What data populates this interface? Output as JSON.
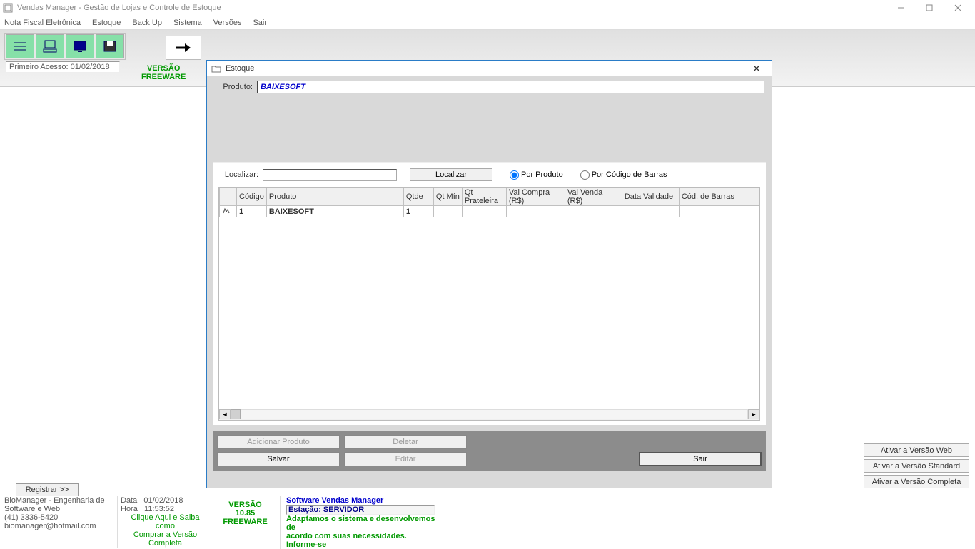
{
  "title": "Vendas Manager - Gestão de Lojas e Controle de Estoque",
  "menu": {
    "nota": "Nota Fiscal Eletrônica",
    "estoque": "Estoque",
    "backup": "Back Up",
    "sistema": "Sistema",
    "versoes": "Versões",
    "sair": "Sair"
  },
  "toolbar": {
    "primeiro_acesso": "Primeiro Acesso: 01/02/2018",
    "versao_line1": "VERSÃO",
    "versao_line2": "FREEWARE"
  },
  "ativar": {
    "web": "Ativar a Versão Web",
    "standard": "Ativar a Versão Standard",
    "completa": "Ativar a Versão Completa"
  },
  "register_btn": "Registrar >>",
  "footer": {
    "col1_l1": "BioManager - Engenharia de",
    "col1_l2": "Software e Web",
    "col1_l3": "(41) 3336-5420",
    "col1_l4": "biomanager@hotmail.com",
    "col2_data_lbl": "Data",
    "col2_data_val": "01/02/2018",
    "col2_hora_lbl": "Hora",
    "col2_hora_val": "11:53:52",
    "col2_link1": "Clique Aqui e Saiba como",
    "col2_link2": "Comprar a Versão",
    "col2_link3": "Completa",
    "col3_l1": "VERSÃO",
    "col3_l2": "10.85",
    "col3_l3": "FREEWARE",
    "col4_hdr": "Software Vendas Manager",
    "col4_est": "Estação:  SERVIDOR",
    "col4_d1": "Adaptamos o sistema e desenvolvemos de",
    "col4_d2": "acordo com suas necessidades. Informe-se"
  },
  "modal": {
    "title": "Estoque",
    "close": "✕",
    "produto_lbl": "Produto:",
    "produto_val": "BAIXESOFT",
    "localizar_lbl": "Localizar:",
    "localizar_btn": "Localizar",
    "radio_prod": "Por Produto",
    "radio_bar": "Por Código de Barras",
    "columns": {
      "rowmark": "",
      "codigo": "Código",
      "produto": "Produto",
      "qtde": "Qtde",
      "qtmin": "Qt Mín",
      "qtprat": "Qt Prateleira",
      "valcompra": "Val Compra (R$)",
      "valvenda": "Val Venda (R$)",
      "datavalid": "Data Validade",
      "codbarras": "Cód. de Barras"
    },
    "rows": [
      {
        "codigo": "1",
        "produto": "BAIXESOFT",
        "qtde": "1",
        "qtmin": "",
        "qtprat": "",
        "valcompra": "",
        "valvenda": "",
        "datavalid": "",
        "codbarras": ""
      }
    ],
    "btn_add": "Adicionar Produto",
    "btn_del": "Deletar",
    "btn_salvar": "Salvar",
    "btn_editar": "Editar",
    "btn_sair": "Sair"
  }
}
